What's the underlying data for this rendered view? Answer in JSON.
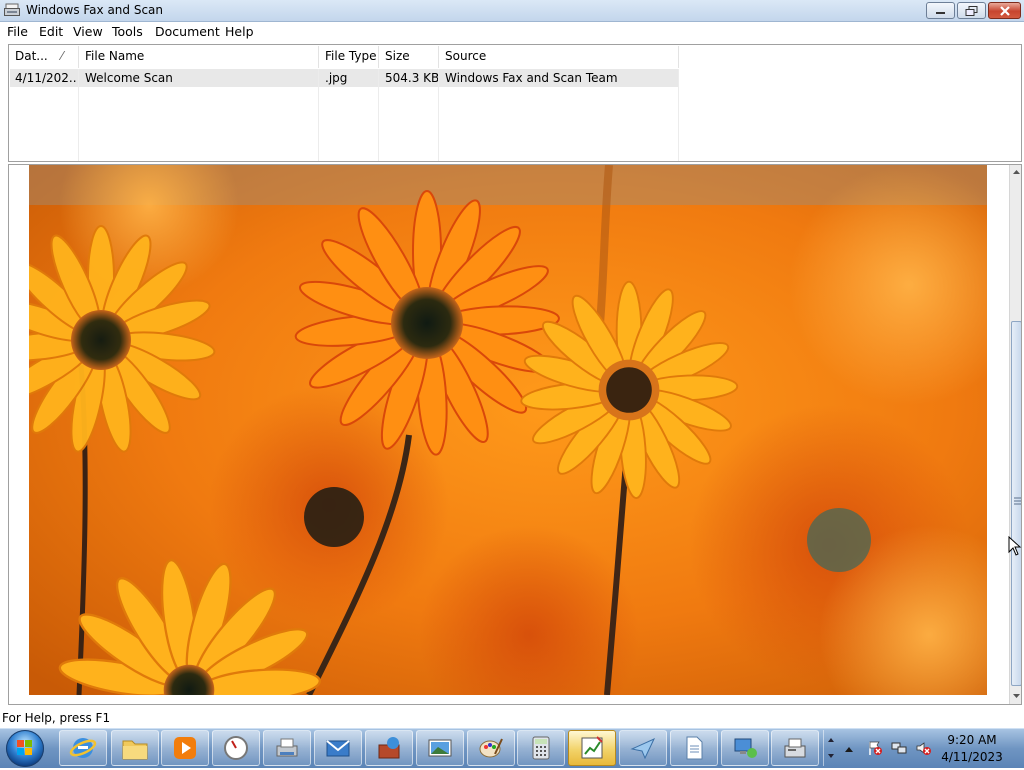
{
  "window": {
    "title": "Windows Fax and Scan",
    "buttons": {
      "minimize": "minimize",
      "maximize": "restore",
      "close": "close"
    }
  },
  "menu": [
    "File",
    "Edit",
    "View",
    "Tools",
    "Document",
    "Help"
  ],
  "list": {
    "columns": [
      {
        "label": "Dat...",
        "sort_indicator": "⁄"
      },
      {
        "label": "File Name"
      },
      {
        "label": "File Type"
      },
      {
        "label": "Size"
      },
      {
        "label": "Source"
      }
    ],
    "rows": [
      {
        "date": "4/11/202...",
        "file_name": "Welcome Scan",
        "file_type": ".jpg",
        "size": "504.3 KB",
        "source": "Windows Fax and Scan Team"
      }
    ]
  },
  "preview": {
    "image": "orange-daisies-photo",
    "scroll_position": 0.55
  },
  "status": {
    "text": "For Help, press F1"
  },
  "taskbar": {
    "items": [
      {
        "icon": "internet-explorer-icon"
      },
      {
        "icon": "file-explorer-icon"
      },
      {
        "icon": "media-player-icon"
      },
      {
        "icon": "stopwatch-icon"
      },
      {
        "icon": "printer-scanner-icon"
      },
      {
        "icon": "mail-icon"
      },
      {
        "icon": "toolbox-icon"
      },
      {
        "icon": "picture-icon"
      },
      {
        "icon": "paint-icon"
      },
      {
        "icon": "calculator-icon"
      },
      {
        "icon": "chart-icon",
        "active": true
      },
      {
        "icon": "paper-plane-icon"
      },
      {
        "icon": "document-icon"
      },
      {
        "icon": "network-computer-icon"
      },
      {
        "icon": "fax-icon"
      }
    ],
    "clock": {
      "time": "9:20 AM",
      "date": "4/11/2023"
    }
  }
}
